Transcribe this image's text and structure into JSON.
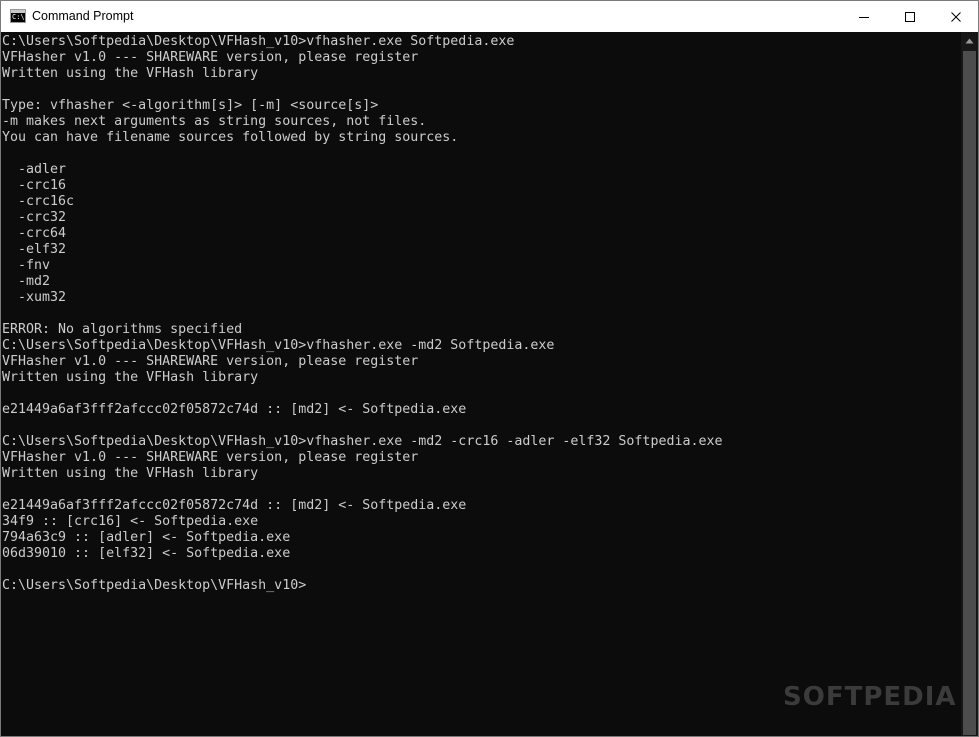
{
  "window": {
    "title": "Command Prompt"
  },
  "app_icon": {
    "glyph": "C:\\"
  },
  "controls": {
    "minimize_icon": "minimize-icon",
    "maximize_icon": "maximize-icon",
    "close_icon": "close-icon"
  },
  "console": {
    "lines": [
      "C:\\Users\\Softpedia\\Desktop\\VFHash_v10>vfhasher.exe Softpedia.exe",
      "VFHasher v1.0 --- SHAREWARE version, please register",
      "Written using the VFHash library",
      "",
      "Type: vfhasher <-algorithm[s]> [-m] <source[s]>",
      "-m makes next arguments as string sources, not files.",
      "You can have filename sources followed by string sources.",
      "",
      "  -adler",
      "  -crc16",
      "  -crc16c",
      "  -crc32",
      "  -crc64",
      "  -elf32",
      "  -fnv",
      "  -md2",
      "  -xum32",
      "",
      "ERROR: No algorithms specified",
      "C:\\Users\\Softpedia\\Desktop\\VFHash_v10>vfhasher.exe -md2 Softpedia.exe",
      "VFHasher v1.0 --- SHAREWARE version, please register",
      "Written using the VFHash library",
      "",
      "e21449a6af3fff2afccc02f05872c74d :: [md2] <- Softpedia.exe",
      "",
      "C:\\Users\\Softpedia\\Desktop\\VFHash_v10>vfhasher.exe -md2 -crc16 -adler -elf32 Softpedia.exe",
      "VFHasher v1.0 --- SHAREWARE version, please register",
      "Written using the VFHash library",
      "",
      "e21449a6af3fff2afccc02f05872c74d :: [md2] <- Softpedia.exe",
      "34f9 :: [crc16] <- Softpedia.exe",
      "794a63c9 :: [adler] <- Softpedia.exe",
      "06d39010 :: [elf32] <- Softpedia.exe",
      "",
      "C:\\Users\\Softpedia\\Desktop\\VFHash_v10>"
    ]
  },
  "watermark": "SOFTPEDIA",
  "colors": {
    "background": "#0c0c0c",
    "text": "#cccccc",
    "titlebar": "#ffffff"
  }
}
